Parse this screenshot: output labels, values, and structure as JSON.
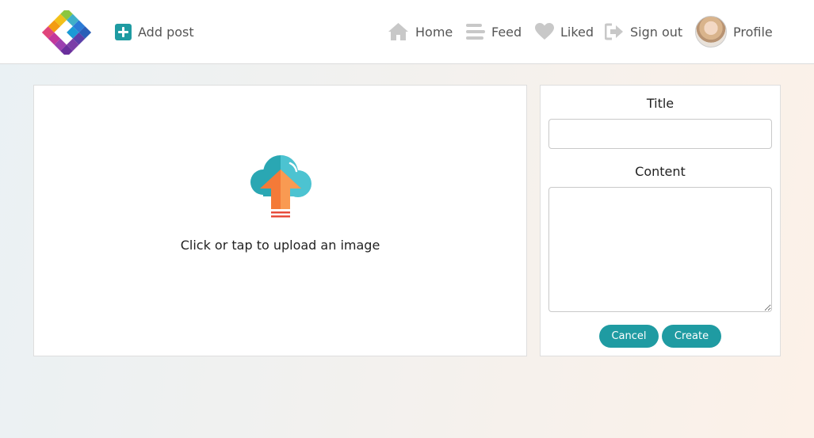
{
  "header": {
    "add_post_label": "Add post",
    "nav": {
      "home": "Home",
      "feed": "Feed",
      "liked": "Liked",
      "signout": "Sign out",
      "profile": "Profile"
    }
  },
  "upload": {
    "prompt": "Click or tap to upload an image"
  },
  "form": {
    "title_label": "Title",
    "title_value": "",
    "content_label": "Content",
    "content_value": "",
    "cancel_label": "Cancel",
    "create_label": "Create"
  },
  "colors": {
    "accent": "#1f9ba2",
    "nav_icon": "#c8c8c8",
    "upload_arrow": "#f47a38",
    "upload_cloud": "#2aa7b3"
  },
  "icons": {
    "logo": "app-logo-icon",
    "add": "plus-square-icon",
    "home": "home-icon",
    "feed": "bars-icon",
    "liked": "heart-icon",
    "signout": "sign-out-icon",
    "upload": "cloud-upload-icon"
  }
}
